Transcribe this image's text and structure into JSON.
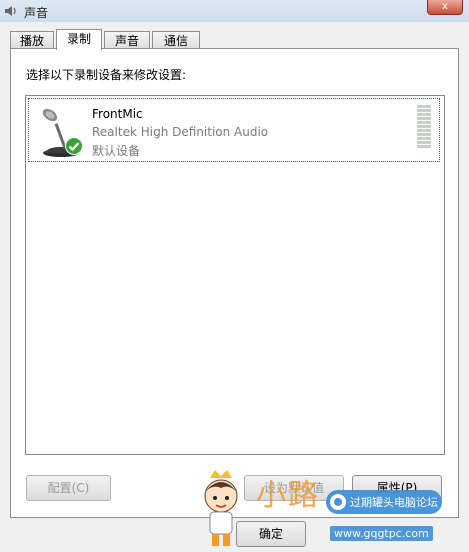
{
  "window": {
    "title": "声音",
    "close_label": "x"
  },
  "tabs": [
    {
      "label": "播放",
      "active": false
    },
    {
      "label": "录制",
      "active": true
    },
    {
      "label": "声音",
      "active": false
    },
    {
      "label": "通信",
      "active": false
    }
  ],
  "main": {
    "instruction": "选择以下录制设备来修改设置:",
    "devices": [
      {
        "name": "FrontMic",
        "driver": "Realtek High Definition Audio",
        "status": "默认设备",
        "icon": "microphone-icon",
        "default_badge": "green-check-icon"
      }
    ]
  },
  "buttons": {
    "configure": "配置(C)",
    "set_default": "设为默认值",
    "properties": "属性(P)",
    "ok": "确定"
  },
  "watermark": {
    "logo_text": "小路",
    "forum_text": "过期罐头电脑论坛",
    "url": "www.gqgtpc.com"
  },
  "colors": {
    "accent": "#3c8ed8",
    "check": "#3aa335",
    "watermark_orange": "#f39a2b"
  }
}
